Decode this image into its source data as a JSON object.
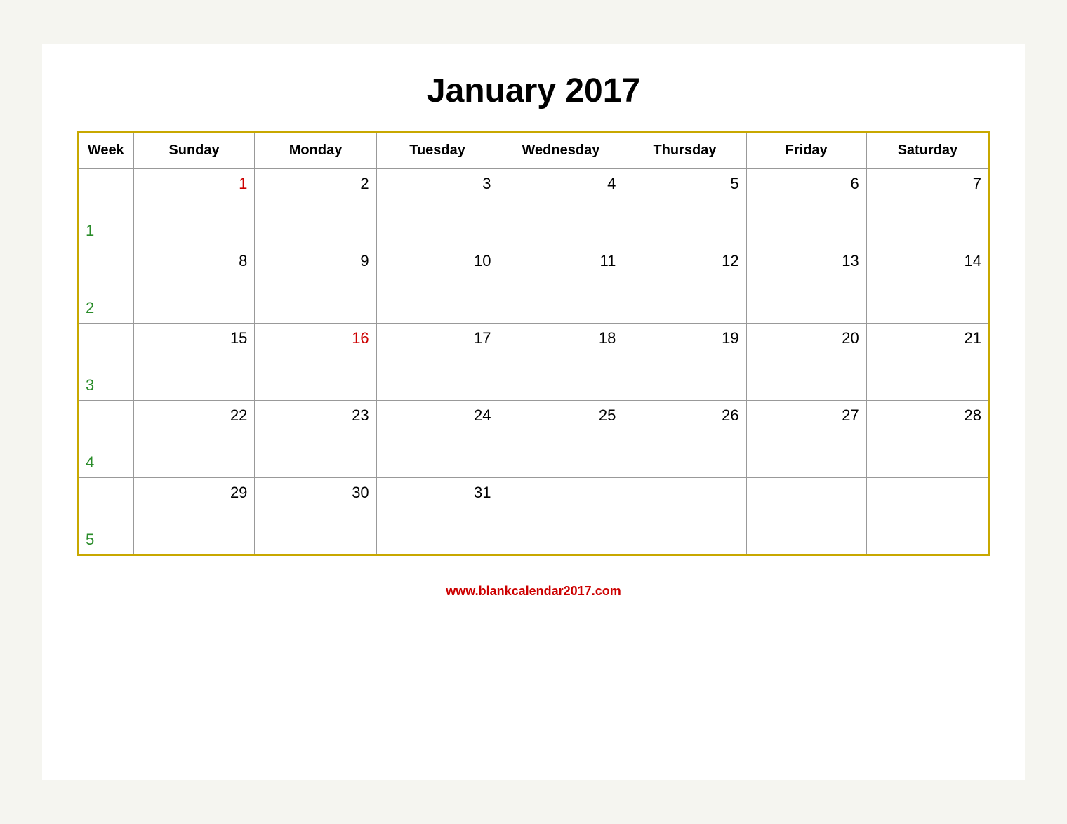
{
  "calendar": {
    "title": "January 2017",
    "footer_url": "www.blankcalendar2017.com",
    "headers": [
      "Week",
      "Sunday",
      "Monday",
      "Tuesday",
      "Wednesday",
      "Thursday",
      "Friday",
      "Saturday"
    ],
    "weeks": [
      {
        "week_num": "1",
        "days": [
          {
            "date": "1",
            "color": "red"
          },
          {
            "date": "2",
            "color": "black"
          },
          {
            "date": "3",
            "color": "black"
          },
          {
            "date": "4",
            "color": "black"
          },
          {
            "date": "5",
            "color": "black"
          },
          {
            "date": "6",
            "color": "black"
          },
          {
            "date": "7",
            "color": "black"
          }
        ]
      },
      {
        "week_num": "2",
        "days": [
          {
            "date": "8",
            "color": "black"
          },
          {
            "date": "9",
            "color": "black"
          },
          {
            "date": "10",
            "color": "black"
          },
          {
            "date": "11",
            "color": "black"
          },
          {
            "date": "12",
            "color": "black"
          },
          {
            "date": "13",
            "color": "black"
          },
          {
            "date": "14",
            "color": "black"
          }
        ]
      },
      {
        "week_num": "3",
        "days": [
          {
            "date": "15",
            "color": "black"
          },
          {
            "date": "16",
            "color": "red"
          },
          {
            "date": "17",
            "color": "black"
          },
          {
            "date": "18",
            "color": "black"
          },
          {
            "date": "19",
            "color": "black"
          },
          {
            "date": "20",
            "color": "black"
          },
          {
            "date": "21",
            "color": "black"
          }
        ]
      },
      {
        "week_num": "4",
        "days": [
          {
            "date": "22",
            "color": "black"
          },
          {
            "date": "23",
            "color": "black"
          },
          {
            "date": "24",
            "color": "black"
          },
          {
            "date": "25",
            "color": "black"
          },
          {
            "date": "26",
            "color": "black"
          },
          {
            "date": "27",
            "color": "black"
          },
          {
            "date": "28",
            "color": "black"
          }
        ]
      },
      {
        "week_num": "5",
        "days": [
          {
            "date": "29",
            "color": "black"
          },
          {
            "date": "30",
            "color": "black"
          },
          {
            "date": "31",
            "color": "black"
          },
          {
            "date": "",
            "color": "black"
          },
          {
            "date": "",
            "color": "black"
          },
          {
            "date": "",
            "color": "black"
          },
          {
            "date": "",
            "color": "black"
          }
        ]
      }
    ]
  }
}
